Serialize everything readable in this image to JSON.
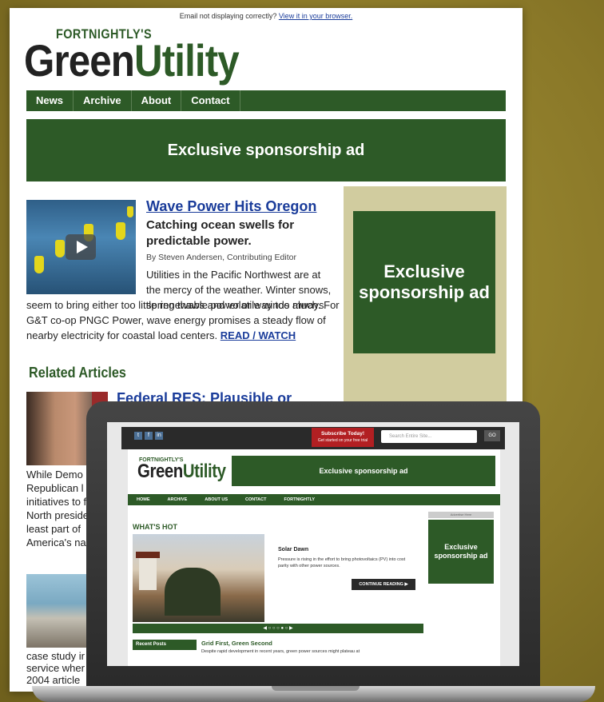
{
  "email": {
    "notice_text": "Email not displaying correctly?",
    "notice_link": "View it in your browser.",
    "logo_small": "FORTNIGHTLY'S",
    "logo_green_a": "Green",
    "logo_green_b": "Utility",
    "nav": [
      "News",
      "Archive",
      "About",
      "Contact"
    ],
    "banner_ad": "Exclusive sponsorship ad",
    "side_ad": "Exclusive sponsorship ad",
    "article": {
      "title": "Wave Power Hits Oregon",
      "subtitle": "Catching ocean swells for predictable power.",
      "byline": "By Steven Andersen, Contributing Editor",
      "body_a": "Utilities in the Pacific Northwest are at the mercy of the weather. Winter snows, spring thaws and volatile winds always",
      "body_b": "seem to bring either too little renewable power or way too much. For G&T co-op PNGC Power, wave energy promises a steady flow of nearby electricity for coastal load centers.",
      "read_more": "READ / WATCH"
    },
    "related_heading": "Related Articles",
    "related2_title": "Federal RES: Plausible or",
    "related2_body": "While Demo Republican l initiatives to former North president, sa least part of America's na",
    "related3_body": "case study ir service wher 2004 article"
  },
  "laptop": {
    "social": [
      "t",
      "f",
      "in"
    ],
    "subscribe_title": "Subscribe Today!",
    "subscribe_sub": "Get started on your free trial",
    "search_placeholder": "Search Entire Site...",
    "search_btn": "GO",
    "logo_small": "FORTNIGHTLY'S",
    "logo_green_a": "Green",
    "logo_green_b": "Utility",
    "banner_ad": "Exclusive sponsorship ad",
    "nav": [
      "HOME",
      "ARCHIVE",
      "ABOUT US",
      "CONTACT",
      "FORTNIGHTLY"
    ],
    "whats_hot": "WHAT'S HOT",
    "feature_title": "Solar Dawn",
    "feature_desc": "Pressure is rising in the effort to bring photovoltaics (PV) into cost parity with other power sources.",
    "continue": "CONTINUE READING ▶",
    "pager": "◀ ○ ○ ○ ● ○ ▶",
    "recent_posts": "Recent Posts",
    "grid_title": "Grid First, Green Second",
    "grid_desc": "Despite rapid development in recent years, green power sources might plateau at",
    "ad_label": "Advertise Here",
    "side_ad": "Exclusive sponsorship ad"
  },
  "colors": {
    "brand_green": "#2d5a27",
    "link_blue": "#1a3c9a",
    "background": "#8c7a2a",
    "sidebar_tan": "#d1cc9f"
  }
}
